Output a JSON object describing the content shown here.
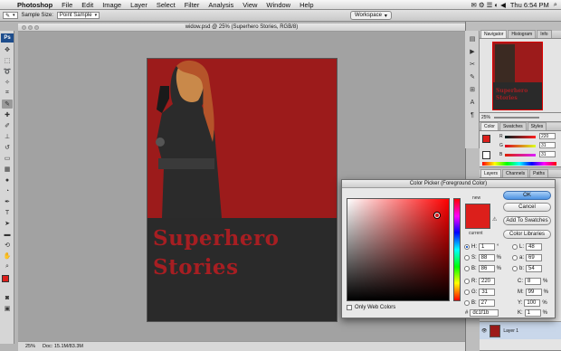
{
  "menubar": {
    "app_name": "Photoshop",
    "items": [
      "File",
      "Edit",
      "Image",
      "Layer",
      "Select",
      "Filter",
      "Analysis",
      "View",
      "Window",
      "Help"
    ],
    "status_right": {
      "clock": "Thu 6:54 PM"
    }
  },
  "options_bar": {
    "sample_size_label": "Sample Size:",
    "sample_size_value": "Point Sample",
    "workspace_label": "Workspace"
  },
  "document": {
    "title": "widow.psd @ 25% (Superhero  Stories, RGB/8)",
    "headline_line1": "Superhero",
    "headline_line2": "Stories",
    "zoom": "25%",
    "doc_info": "Doc: 15.1M/83.3M"
  },
  "panels": {
    "navigator_tabs": [
      "Navigator",
      "Histogram",
      "Info"
    ],
    "navigator_zoom": "25%",
    "navigator_preview_text": [
      "Superhero",
      "Stories"
    ],
    "color_tabs": [
      "Color",
      "Swatches",
      "Styles"
    ],
    "color_values": {
      "R": "220",
      "G": "31",
      "B": "31"
    },
    "layers_tabs": [
      "Layers",
      "Channels",
      "Paths"
    ],
    "layer_name": "Layer 1"
  },
  "color_picker": {
    "title": "Color Picker (Foreground Color)",
    "new_label": "new",
    "current_label": "current",
    "buttons": {
      "ok": "OK",
      "cancel": "Cancel",
      "add_to_swatches": "Add To Swatches",
      "color_libraries": "Color Libraries"
    },
    "fields": {
      "H": "1",
      "H_unit": "°",
      "S": "88",
      "S_unit": "%",
      "B": "86",
      "B_unit": "%",
      "R": "220",
      "G": "31",
      "Bl": "27",
      "L": "48",
      "a": "69",
      "b": "54",
      "C": "8",
      "M": "99",
      "Y": "100",
      "K": "1",
      "pct": "%"
    },
    "hex_label": "#",
    "hex": "dc1f1b",
    "only_web_colors": "Only Web Colors"
  },
  "colors": {
    "accent_red": "#dc1f1b",
    "canvas_red": "#9c1b1b",
    "title_red": "#a71e22",
    "doc_dark": "#2a2a2a"
  }
}
